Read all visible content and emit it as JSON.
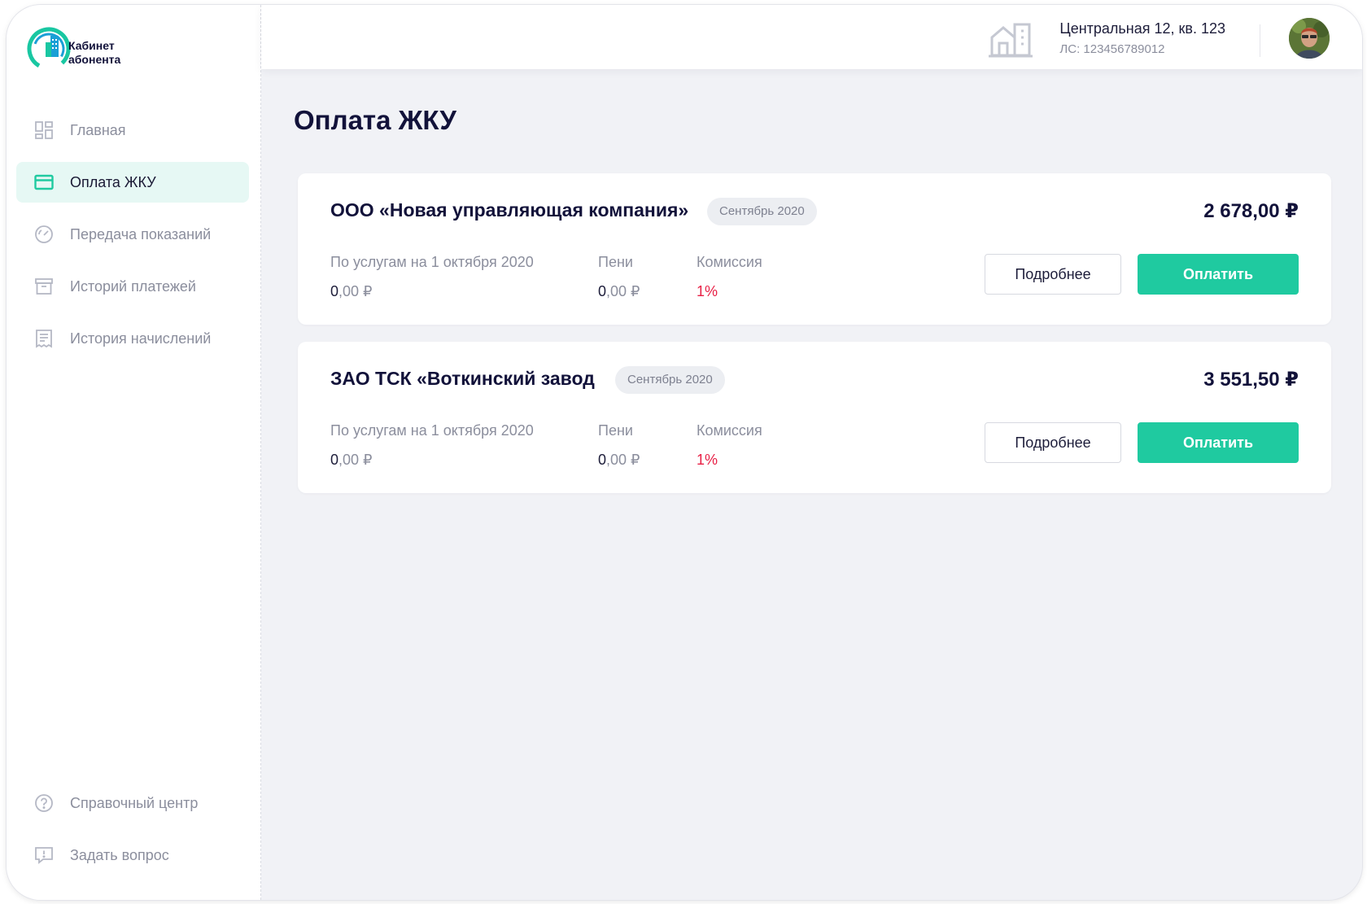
{
  "sidebar": {
    "logo_line1": "Кабинет",
    "logo_line2": "абонента",
    "items": [
      {
        "label": "Главная",
        "icon": "dashboard-icon"
      },
      {
        "label": "Оплата ЖКУ",
        "icon": "card-icon",
        "active": true
      },
      {
        "label": "Передача показаний",
        "icon": "gauge-icon"
      },
      {
        "label": "Историй платежей",
        "icon": "archive-icon"
      },
      {
        "label": "История начислений",
        "icon": "receipt-icon"
      }
    ],
    "bottom_items": [
      {
        "label": "Справочный центр",
        "icon": "help-icon"
      },
      {
        "label": "Задать вопрос",
        "icon": "chat-question-icon"
      }
    ]
  },
  "header": {
    "address": "Центральная 12, кв. 123",
    "account": "ЛС: 123456789012"
  },
  "page": {
    "title": "Оплата ЖКУ"
  },
  "cards": [
    {
      "company": "ООО «Новая управляющая компания»",
      "period": "Сентябрь 2020",
      "amount": "2 678,00 ₽",
      "services_label": "По услугам на 1 октября 2020",
      "services_int": "0",
      "services_rest": ",00 ₽",
      "fines_label": "Пени",
      "fines_int": "0",
      "fines_rest": ",00 ₽",
      "commission_label": "Комиссия",
      "commission_value": "1%",
      "details_label": "Подробнее",
      "pay_label": "Оплатить"
    },
    {
      "company": "ЗАО ТСК «Воткинский завод",
      "period": "Сентябрь 2020",
      "amount": "3 551,50 ₽",
      "services_label": "По услугам на 1 октября 2020",
      "services_int": "0",
      "services_rest": ",00 ₽",
      "fines_label": "Пени",
      "fines_int": "0",
      "fines_rest": ",00 ₽",
      "commission_label": "Комиссия",
      "commission_value": "1%",
      "details_label": "Подробнее",
      "pay_label": "Оплатить"
    }
  ],
  "colors": {
    "accent": "#1fcaa0",
    "active_bg": "#e6f8f4",
    "commission_red": "#e81f45",
    "page_bg": "#f1f2f6"
  }
}
